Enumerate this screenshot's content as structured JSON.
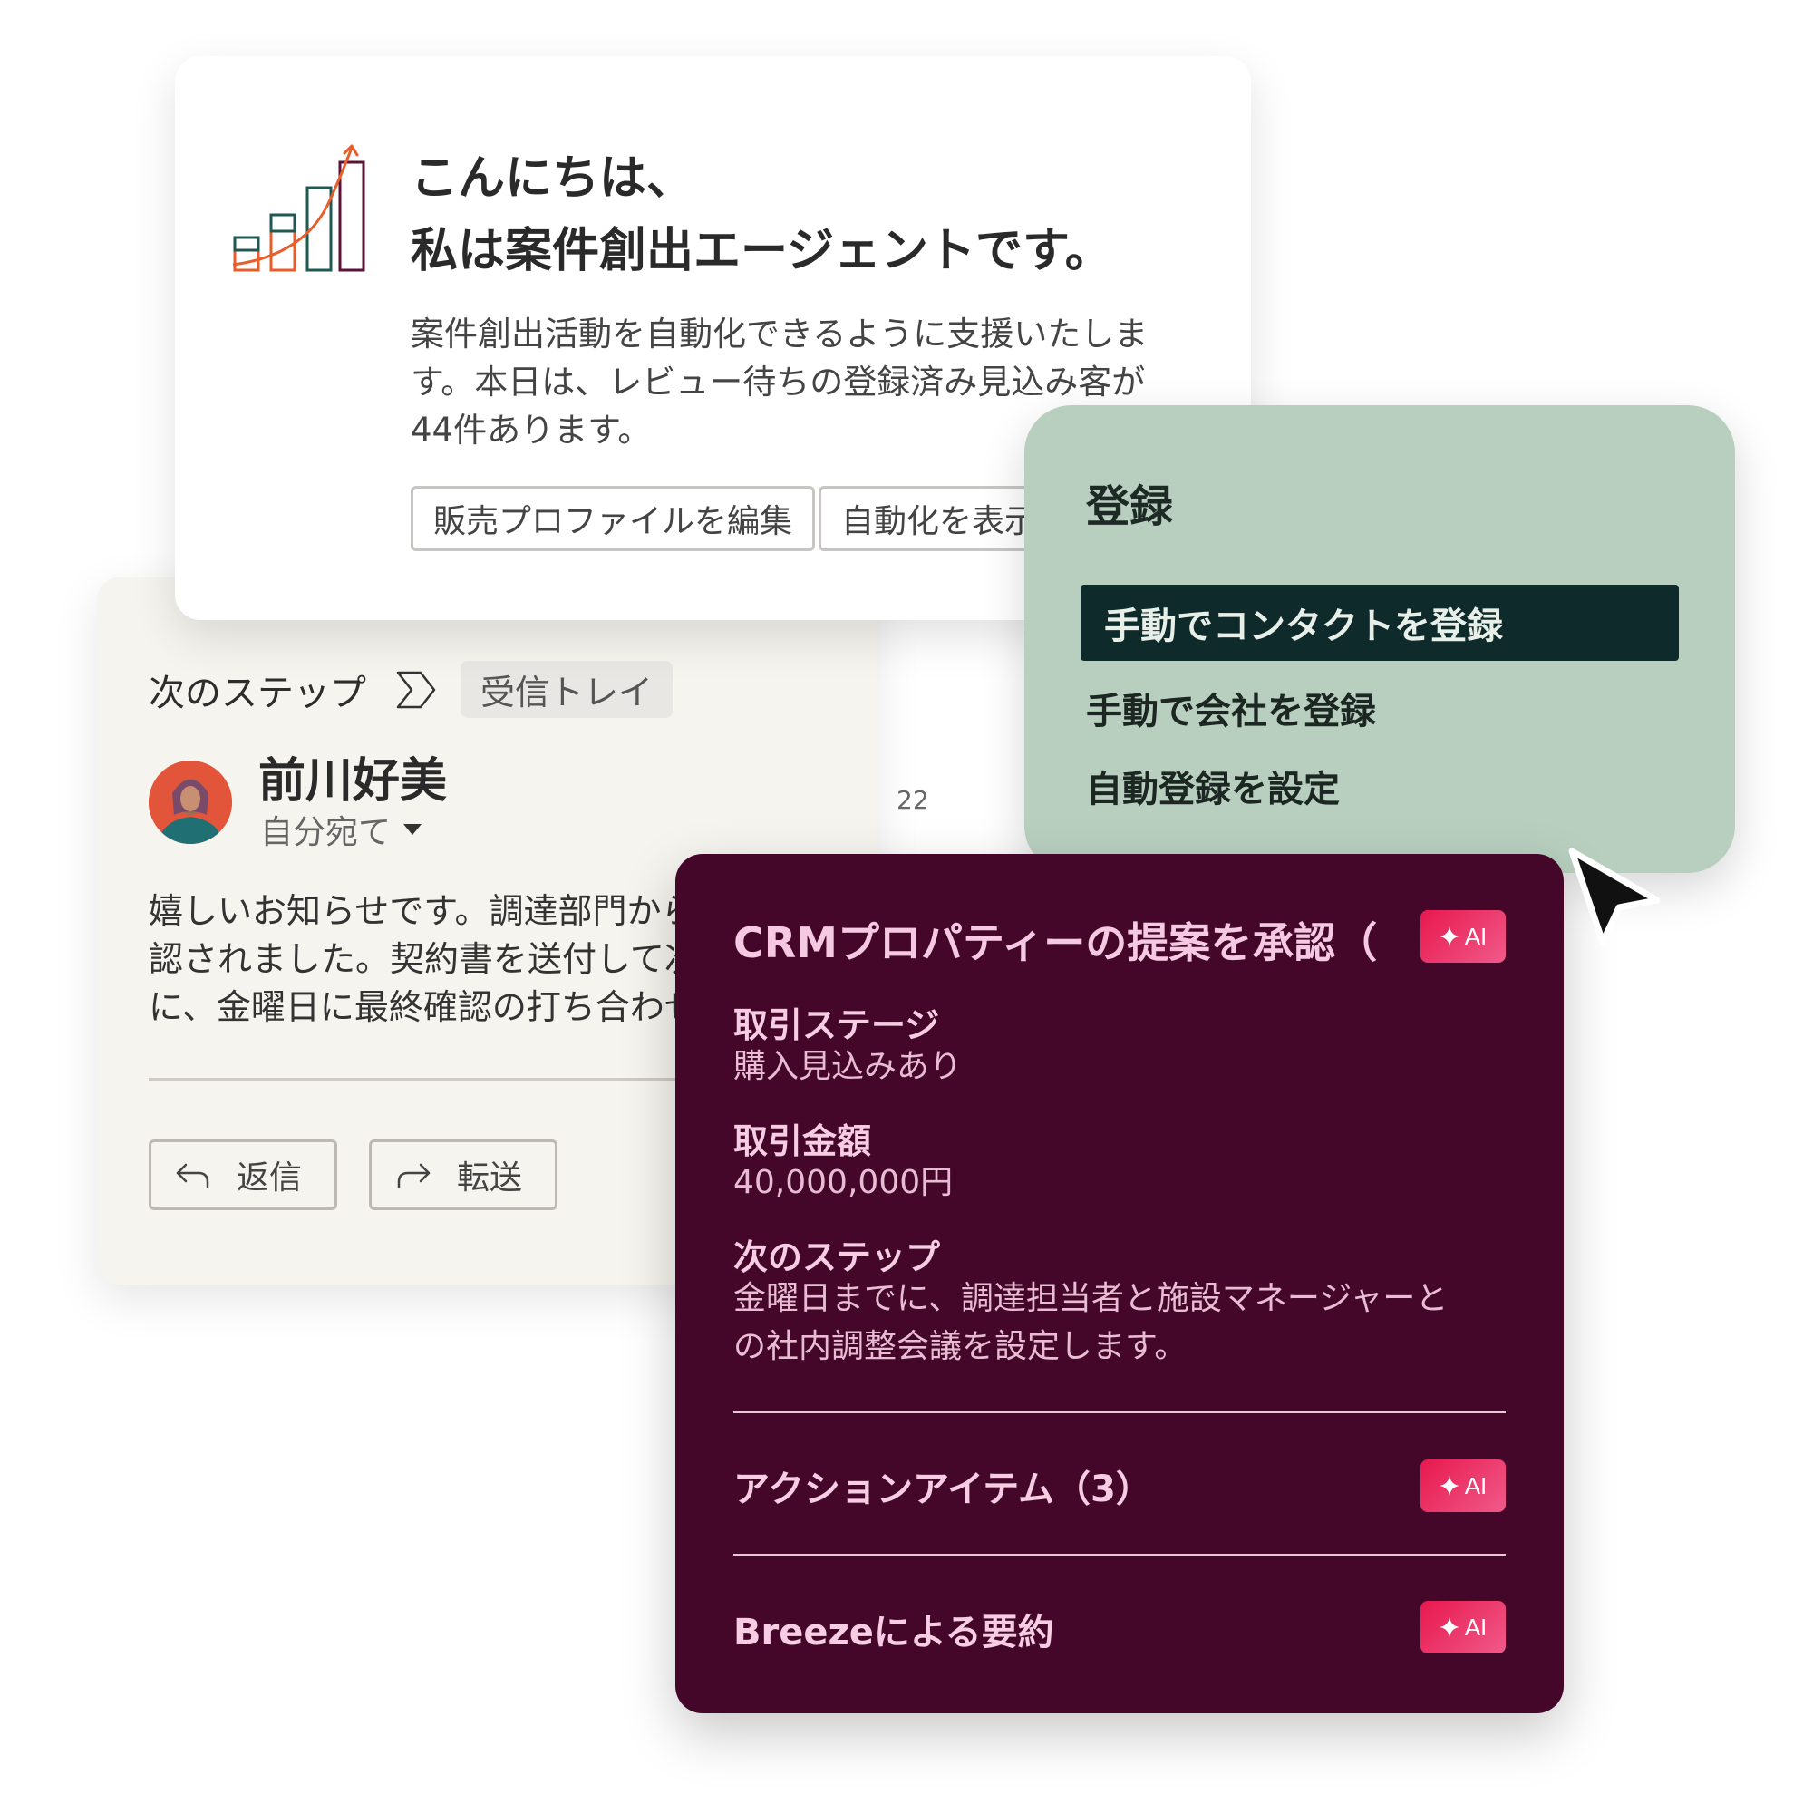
{
  "agent": {
    "greeting_line1": "こんにちは、",
    "greeting_line2": "私は案件創出エージェントです。",
    "description": "案件創出活動を自動化できるように支援いたしま\nす。本日は、レビュー待ちの登録済み見込み客が\n44件あります。",
    "edit_profile_label": "販売プロファイルを編集",
    "view_automation_label": "自動化を表示",
    "icon": "growth-chart-icon"
  },
  "email": {
    "breadcrumb_step": "次のステップ",
    "breadcrumb_chip": "受信トレイ",
    "sender_name": "前川好美",
    "recipient": "自分宛て",
    "time": "22",
    "body": "嬉しいお知らせです。調達部門から\n認されました。契約書を送付して次\nに、金曜日に最終確認の打ち合わせ",
    "reply_label": "返信",
    "forward_label": "転送"
  },
  "register_menu": {
    "title": "登録",
    "items": [
      {
        "label": "手動でコンタクトを登録",
        "active": true
      },
      {
        "label": "手動で会社を登録",
        "active": false
      },
      {
        "label": "自動登録を設定",
        "active": false
      }
    ]
  },
  "crm": {
    "title": "CRMプロパティーの提案を承認（",
    "ai_badge": "AI",
    "fields": {
      "stage_label": "取引ステージ",
      "stage_value": "購入見込みあり",
      "amount_label": "取引金額",
      "amount_value": "40,000,000円",
      "next_label": "次のステップ",
      "next_value": "金曜日までに、調達担当者と施設マネージャーと\nの社内調整会議を設定します。"
    },
    "action_items_label": "アクションアイテム（3）",
    "summary_label": "Breezeによる要約"
  },
  "colors": {
    "crm_bg": "#44072a",
    "register_bg": "#b8cfbf",
    "menu_active_bg": "#0e2a2a",
    "ai_badge": "#e8184e",
    "email_bg": "#f6f4ee"
  }
}
